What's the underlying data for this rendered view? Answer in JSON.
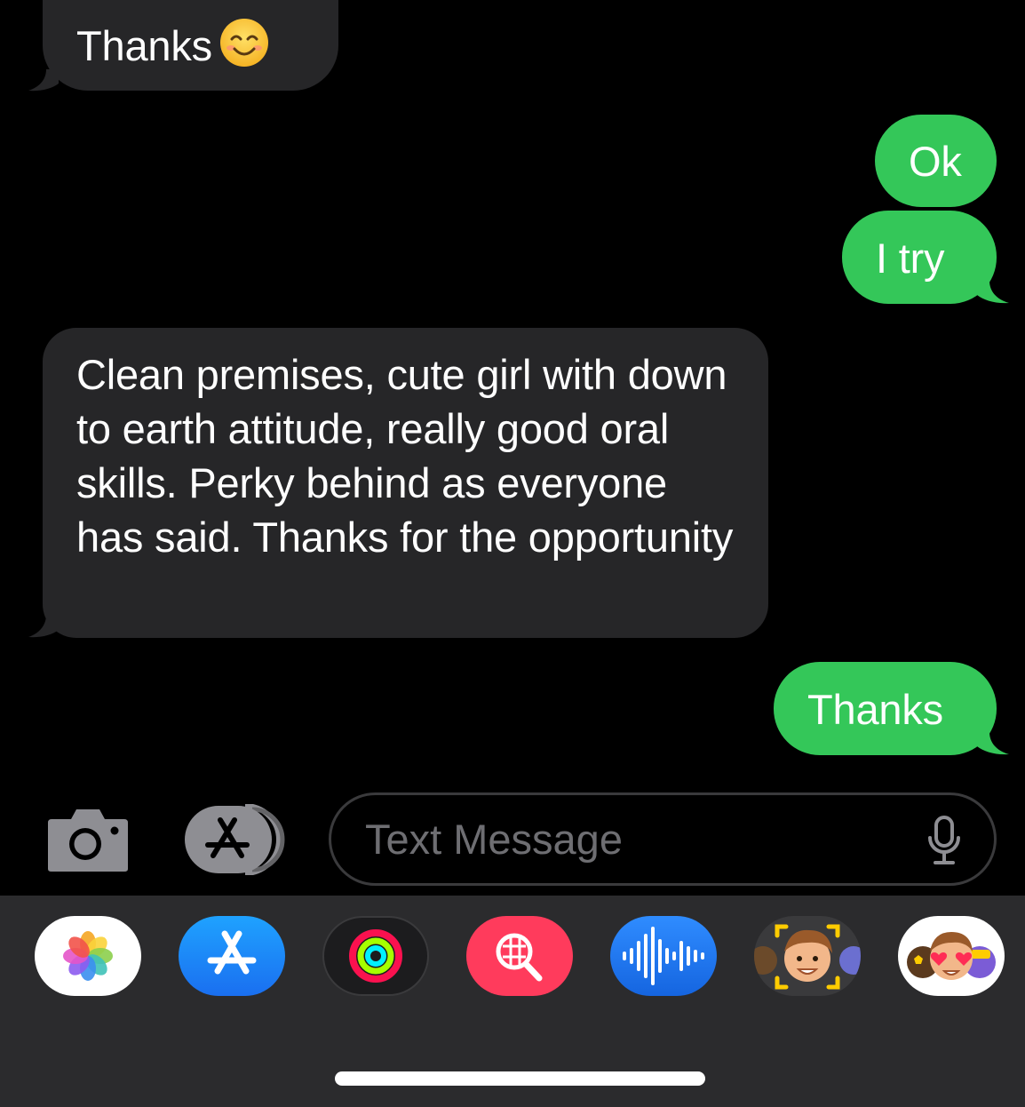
{
  "conversation": {
    "messages": [
      {
        "direction": "received",
        "text": "Thanks",
        "emoji": "smiling-face-icon"
      },
      {
        "direction": "sent",
        "text": "Ok"
      },
      {
        "direction": "sent",
        "text": "I try"
      },
      {
        "direction": "received",
        "text": "Clean premises, cute girl with down to earth attitude, really good oral skills. Perky behind as everyone has said. Thanks for the opportunity"
      },
      {
        "direction": "sent",
        "text": "Thanks"
      }
    ]
  },
  "composer": {
    "placeholder": "Text Message",
    "camera_icon": "camera-icon",
    "apps_icon": "app-store-icon",
    "mic_icon": "microphone-icon"
  },
  "app_drawer": {
    "apps": [
      "photos",
      "app-store",
      "activity",
      "images-search",
      "audio",
      "memoji-camera",
      "memoji-stickers"
    ]
  },
  "colors": {
    "background": "#000000",
    "received_bubble": "#262628",
    "sent_bubble": "#34c759",
    "drawer": "#2b2b2d"
  }
}
